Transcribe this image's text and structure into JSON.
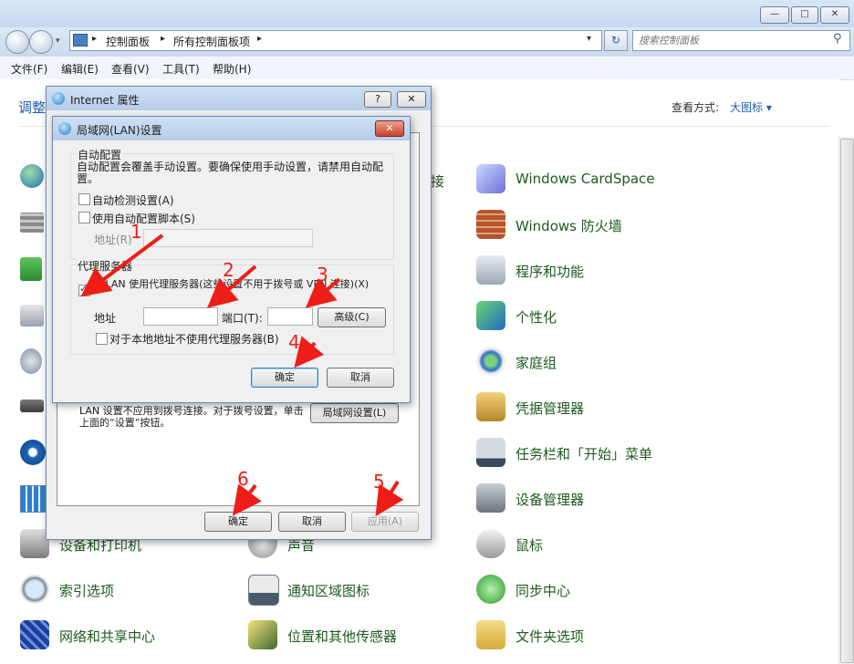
{
  "window": {
    "caption_buttons": [
      "—",
      "□",
      "✕"
    ],
    "breadcrumb": [
      "控制面板",
      "所有控制面板项"
    ],
    "search_placeholder": "搜索控制面板",
    "menu": [
      "文件(F)",
      "编辑(E)",
      "查看(V)",
      "工具(T)",
      "帮助(H)"
    ],
    "page_heading_partial": "调整",
    "view_by_label": "查看方式:",
    "view_by_value": "大图标 ▾",
    "partial_label_connect": "接"
  },
  "cp_items_right": [
    {
      "label": "Windows CardSpace",
      "icon": "cardspace-icon"
    },
    {
      "label": "Windows 防火墙",
      "icon": "firewall-icon"
    },
    {
      "label": "程序和功能",
      "icon": "programs-icon"
    },
    {
      "label": "个性化",
      "icon": "personalize-icon"
    },
    {
      "label": "家庭组",
      "icon": "homegroup-icon"
    },
    {
      "label": "凭据管理器",
      "icon": "credential-icon"
    },
    {
      "label": "任务栏和「开始」菜单",
      "icon": "taskbar-icon"
    },
    {
      "label": "设备管理器",
      "icon": "device-manager-icon"
    },
    {
      "label": "鼠标",
      "icon": "mouse-icon"
    },
    {
      "label": "同步中心",
      "icon": "sync-icon"
    },
    {
      "label": "文件夹选项",
      "icon": "folder-options-icon"
    }
  ],
  "cp_items_bottom_left": [
    {
      "label": "设备和打印机",
      "icon": "printer-icon"
    },
    {
      "label": "索引选项",
      "icon": "index-icon"
    },
    {
      "label": "网络和共享中心",
      "icon": "network-icon"
    }
  ],
  "cp_items_bottom_mid": [
    {
      "label": "声音",
      "icon": "sound-icon"
    },
    {
      "label": "通知区域图标",
      "icon": "notify-icon"
    },
    {
      "label": "位置和其他传感器",
      "icon": "sensor-icon"
    }
  ],
  "internet_dialog": {
    "title": "Internet 属性",
    "help_button": "?",
    "close_button": "✕",
    "lan_note": "LAN 设置不应用到拨号连接。对于拨号设置，单击上面的“设置”按钮。",
    "lan_settings_button": "局域网设置(L)",
    "ok": "确定",
    "cancel": "取消",
    "apply": "应用(A)"
  },
  "lan_dialog": {
    "title": "局域网(LAN)设置",
    "close_button": "✕",
    "auto_group": "自动配置",
    "auto_desc": "自动配置会覆盖手动设置。要确保使用手动设置，请禁用自动配置。",
    "auto_detect": "自动检测设置(A)",
    "auto_detect_checked": false,
    "use_script": "使用自动配置脚本(S)",
    "use_script_checked": false,
    "script_address_label": "地址(R)",
    "proxy_group": "代理服务器",
    "use_proxy": "为 LAN 使用代理服务器(这些设置不用于拨号或 VPN 连接)(X)",
    "use_proxy_checked": true,
    "address_label": "地址",
    "address_value": "",
    "port_label": "端口(T):",
    "port_value": "",
    "advanced_button": "高级(C)",
    "bypass_local": "对于本地地址不使用代理服务器(B)",
    "bypass_local_checked": false,
    "ok": "确定",
    "cancel": "取消"
  },
  "annotations": [
    "1",
    "2",
    "3",
    "4",
    "5",
    "6"
  ],
  "colors": {
    "annotation": "#ef1d17",
    "link_green": "#1d5a1d",
    "accent_blue": "#1c5fb0"
  }
}
